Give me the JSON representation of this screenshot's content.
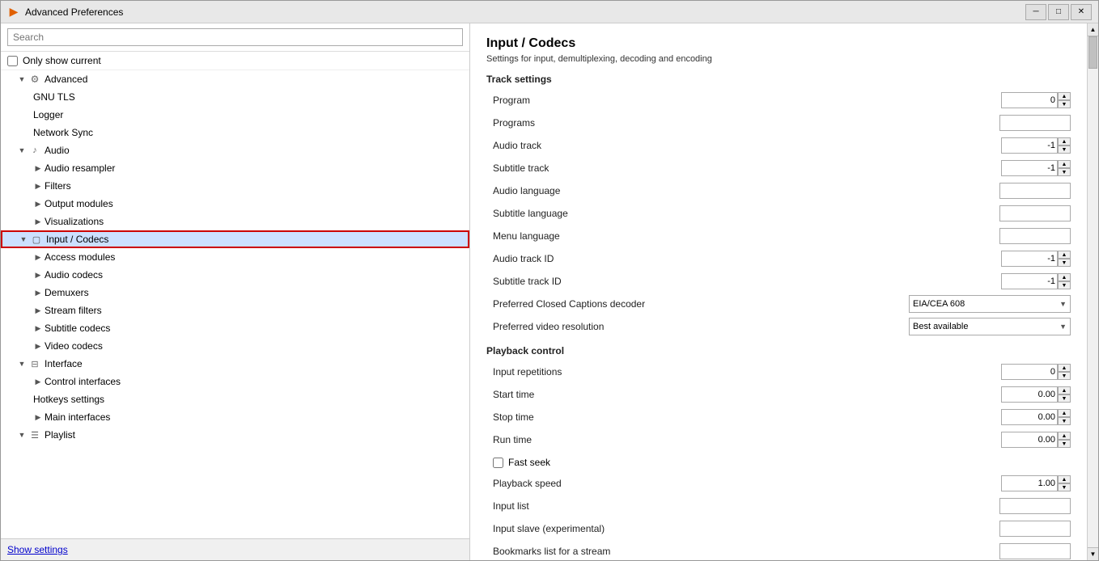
{
  "window": {
    "title": "Advanced Preferences"
  },
  "titlebar": {
    "minimize": "─",
    "restore": "□",
    "close": "✕"
  },
  "left": {
    "search_placeholder": "Search",
    "only_current_label": "Only show current",
    "tree": [
      {
        "id": "advanced",
        "label": "Advanced",
        "level": 1,
        "has_chevron": true,
        "chevron": "▼",
        "icon": "gear"
      },
      {
        "id": "gnu-tls",
        "label": "GNU TLS",
        "level": 2,
        "has_chevron": false,
        "icon": "none"
      },
      {
        "id": "logger",
        "label": "Logger",
        "level": 2,
        "has_chevron": false,
        "icon": "none"
      },
      {
        "id": "network-sync",
        "label": "Network Sync",
        "level": 2,
        "has_chevron": false,
        "icon": "none"
      },
      {
        "id": "audio",
        "label": "Audio",
        "level": 1,
        "has_chevron": true,
        "chevron": "▼",
        "icon": "music"
      },
      {
        "id": "audio-resampler",
        "label": "Audio resampler",
        "level": 2,
        "has_chevron": true,
        "chevron": "▶",
        "icon": "none"
      },
      {
        "id": "filters",
        "label": "Filters",
        "level": 2,
        "has_chevron": true,
        "chevron": "▶",
        "icon": "none"
      },
      {
        "id": "output-modules",
        "label": "Output modules",
        "level": 2,
        "has_chevron": true,
        "chevron": "▶",
        "icon": "none"
      },
      {
        "id": "visualizations",
        "label": "Visualizations",
        "level": 2,
        "has_chevron": true,
        "chevron": "▶",
        "icon": "none"
      },
      {
        "id": "input-codecs",
        "label": "Input / Codecs",
        "level": 1,
        "has_chevron": true,
        "chevron": "▼",
        "icon": "input",
        "selected": true
      },
      {
        "id": "access-modules",
        "label": "Access modules",
        "level": 2,
        "has_chevron": true,
        "chevron": "▶",
        "icon": "none"
      },
      {
        "id": "audio-codecs",
        "label": "Audio codecs",
        "level": 2,
        "has_chevron": true,
        "chevron": "▶",
        "icon": "none"
      },
      {
        "id": "demuxers",
        "label": "Demuxers",
        "level": 2,
        "has_chevron": true,
        "chevron": "▶",
        "icon": "none"
      },
      {
        "id": "stream-filters",
        "label": "Stream filters",
        "level": 2,
        "has_chevron": true,
        "chevron": "▶",
        "icon": "none"
      },
      {
        "id": "subtitle-codecs",
        "label": "Subtitle codecs",
        "level": 2,
        "has_chevron": true,
        "chevron": "▶",
        "icon": "none"
      },
      {
        "id": "video-codecs",
        "label": "Video codecs",
        "level": 2,
        "has_chevron": true,
        "chevron": "▶",
        "icon": "none"
      },
      {
        "id": "interface",
        "label": "Interface",
        "level": 1,
        "has_chevron": true,
        "chevron": "▼",
        "icon": "interface"
      },
      {
        "id": "control-interfaces",
        "label": "Control interfaces",
        "level": 2,
        "has_chevron": true,
        "chevron": "▶",
        "icon": "none"
      },
      {
        "id": "hotkeys-settings",
        "label": "Hotkeys settings",
        "level": 2,
        "has_chevron": false,
        "icon": "none"
      },
      {
        "id": "main-interfaces",
        "label": "Main interfaces",
        "level": 2,
        "has_chevron": true,
        "chevron": "▶",
        "icon": "none"
      },
      {
        "id": "playlist",
        "label": "Playlist",
        "level": 1,
        "has_chevron": true,
        "chevron": "▼",
        "icon": "playlist"
      }
    ],
    "bottom_label": "Show settings"
  },
  "right": {
    "title": "Input / Codecs",
    "description": "Settings for input, demultiplexing, decoding and encoding",
    "groups": [
      {
        "id": "track-settings",
        "label": "Track settings",
        "rows": [
          {
            "id": "program",
            "label": "Program",
            "control": "spin",
            "value": "0"
          },
          {
            "id": "programs",
            "label": "Programs",
            "control": "text",
            "value": ""
          },
          {
            "id": "audio-track",
            "label": "Audio track",
            "control": "spin",
            "value": "-1"
          },
          {
            "id": "subtitle-track",
            "label": "Subtitle track",
            "control": "spin",
            "value": "-1"
          },
          {
            "id": "audio-language",
            "label": "Audio language",
            "control": "text",
            "value": ""
          },
          {
            "id": "subtitle-language",
            "label": "Subtitle language",
            "control": "text",
            "value": ""
          },
          {
            "id": "menu-language",
            "label": "Menu language",
            "control": "text",
            "value": ""
          },
          {
            "id": "audio-track-id",
            "label": "Audio track ID",
            "control": "spin",
            "value": "-1"
          },
          {
            "id": "subtitle-track-id",
            "label": "Subtitle track ID",
            "control": "spin",
            "value": "-1"
          },
          {
            "id": "preferred-closed-captions",
            "label": "Preferred Closed Captions decoder",
            "control": "dropdown",
            "value": "EIA/CEA 608"
          },
          {
            "id": "preferred-video-resolution",
            "label": "Preferred video resolution",
            "control": "dropdown",
            "value": "Best available"
          }
        ]
      },
      {
        "id": "playback-control",
        "label": "Playback control",
        "rows": [
          {
            "id": "input-repetitions",
            "label": "Input repetitions",
            "control": "spin",
            "value": "0"
          },
          {
            "id": "start-time",
            "label": "Start time",
            "control": "spin-float",
            "value": "0.00"
          },
          {
            "id": "stop-time",
            "label": "Stop time",
            "control": "spin-float",
            "value": "0.00"
          },
          {
            "id": "run-time",
            "label": "Run time",
            "control": "spin-float",
            "value": "0.00"
          },
          {
            "id": "fast-seek",
            "label": "Fast seek",
            "control": "checkbox",
            "checked": false
          },
          {
            "id": "playback-speed",
            "label": "Playback speed",
            "control": "spin-float",
            "value": "1.00"
          },
          {
            "id": "input-list",
            "label": "Input list",
            "control": "text",
            "value": ""
          },
          {
            "id": "input-slave",
            "label": "Input slave (experimental)",
            "control": "text",
            "value": ""
          },
          {
            "id": "bookmarks",
            "label": "Bookmarks list for a stream",
            "control": "text",
            "value": ""
          }
        ]
      }
    ]
  }
}
